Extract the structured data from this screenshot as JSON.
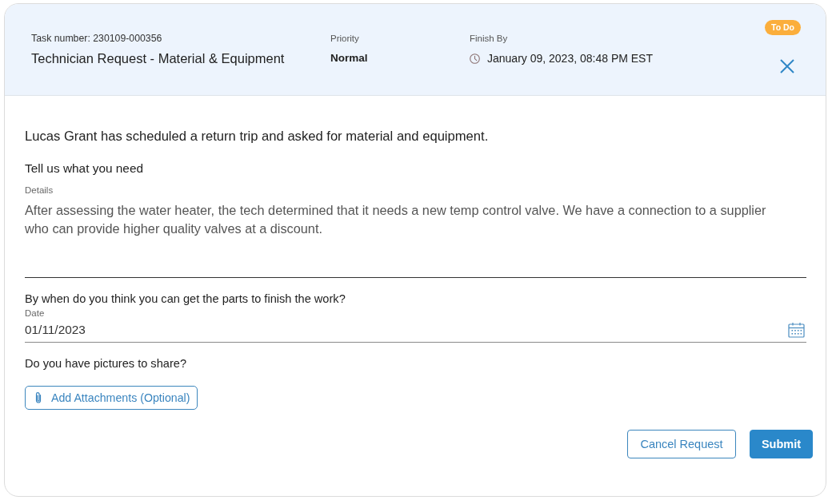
{
  "header": {
    "task_number": "Task number: 230109-000356",
    "title": "Technician Request - Material & Equipment",
    "priority": {
      "label": "Priority",
      "value": "Normal"
    },
    "finish_by": {
      "label": "Finish By",
      "value": "January 09, 2023, 08:48 PM EST"
    },
    "status_badge": "To Do"
  },
  "message": "Lucas Grant has scheduled a return trip and asked for material and equipment.",
  "details_section": {
    "heading": "Tell us what you need",
    "field_label": "Details",
    "value": "After assessing the water heater, the tech determined that it needs a new temp control valve. We have a connection to a supplier who can provide higher quality valves at a discount."
  },
  "date_section": {
    "question": "By when do you think you can get the parts to finish the work?",
    "field_label": "Date",
    "value": "01/11/2023"
  },
  "pictures_section": {
    "question": "Do you have pictures to share?",
    "attach_button": "Add Attachments (Optional)"
  },
  "buttons": [
    {
      "label": "Cancel Request",
      "kind": "secondary"
    },
    {
      "label": "Submit",
      "kind": "primary"
    }
  ]
}
